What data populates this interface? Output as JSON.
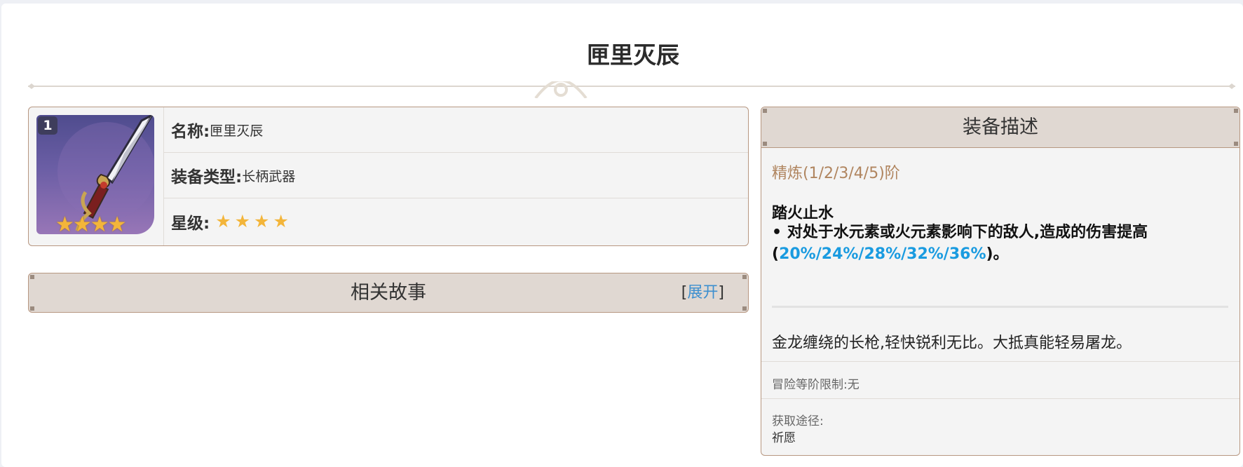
{
  "page_title": "匣里灭辰",
  "info": {
    "refine_badge": "1",
    "name_label": "名称:",
    "name_value": "匣里灭辰",
    "type_label": "装备类型:",
    "type_value": "长柄武器",
    "rarity_label": "星级:",
    "rarity_stars": 4
  },
  "story": {
    "title": "相关故事",
    "toggle_open": "[",
    "toggle_label": "展开",
    "toggle_close": "]"
  },
  "description": {
    "header": "装备描述",
    "refine": "精炼(1/2/3/4/5)阶",
    "skill_name": "踏火止水",
    "skill_text_prefix": "• 对处于水元素或火元素影响下的敌人,造成的伤害提高(",
    "skill_values": "20%/24%/28%/32%/36%",
    "skill_text_suffix": ")。",
    "flavor": "金龙缠绕的长枪,轻快锐利无比。大抵真能轻易屠龙。",
    "level_limit": "冒险等阶限制:无",
    "source_label": "获取途径:",
    "source_value": "祈愿"
  },
  "colors": {
    "accent_link": "#3d8fcf",
    "highlight_value": "#1a9be0",
    "refine_text": "#b0855f",
    "star": "#f3b53a",
    "card_border": "#b79781",
    "header_bg": "#e0d8d2"
  },
  "icons": [
    "weapon-icon",
    "star-icon",
    "ornament-divider-icon"
  ]
}
